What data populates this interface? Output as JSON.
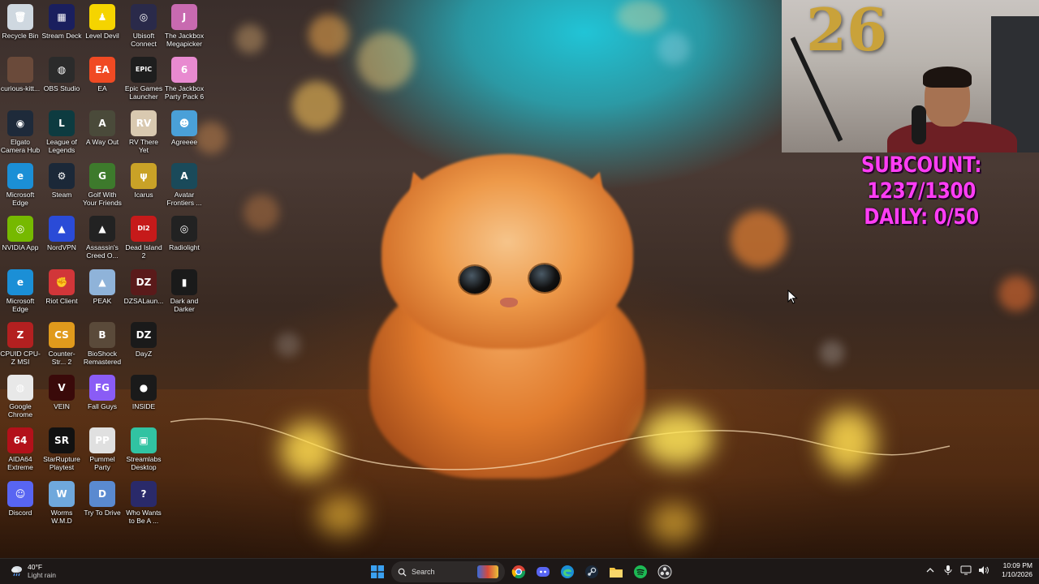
{
  "desktop": {
    "columns": [
      [
        {
          "label": "Recycle Bin",
          "icon": "recycle-bin-icon",
          "color": "#cfd8e0",
          "glyph": "🗑"
        },
        {
          "label": "curious-kitt...",
          "icon": "curious-kitty-icon",
          "color": "#6a4a3a",
          "glyph": ""
        },
        {
          "label": "Elgato Camera Hub",
          "icon": "elgato-icon",
          "color": "#1e2a3a",
          "glyph": "◉"
        },
        {
          "label": "Microsoft Edge",
          "icon": "edge-icon",
          "color": "#1b8fd6",
          "glyph": "e"
        },
        {
          "label": "NVIDIA App",
          "icon": "nvidia-icon",
          "color": "#76b900",
          "glyph": "◎"
        },
        {
          "label": "Microsoft Edge",
          "icon": "edge-icon",
          "color": "#1b8fd6",
          "glyph": "e"
        },
        {
          "label": "CPUID CPU-Z MSI",
          "icon": "cpuz-icon",
          "color": "#b32020",
          "glyph": "Z"
        },
        {
          "label": "Google Chrome",
          "icon": "chrome-icon",
          "color": "#e8e8e8",
          "glyph": "◍"
        },
        {
          "label": "AIDA64 Extreme",
          "icon": "aida64-icon",
          "color": "#b3111a",
          "glyph": "64"
        },
        {
          "label": "Discord",
          "icon": "discord-icon",
          "color": "#5865f2",
          "glyph": "☺"
        }
      ],
      [
        {
          "label": "Stream Deck",
          "icon": "stream-deck-icon",
          "color": "#1a1f5e",
          "glyph": "▦"
        },
        {
          "label": "OBS Studio",
          "icon": "obs-icon",
          "color": "#2b2b2b",
          "glyph": "◍"
        },
        {
          "label": "League of Legends",
          "icon": "league-icon",
          "color": "#0d3b40",
          "glyph": "L"
        },
        {
          "label": "Steam",
          "icon": "steam-icon",
          "color": "#1b2838",
          "glyph": "⚙"
        },
        {
          "label": "NordVPN",
          "icon": "nordvpn-icon",
          "color": "#2a4bd7",
          "glyph": "▲"
        },
        {
          "label": "Riot Client",
          "icon": "riot-icon",
          "color": "#d13639",
          "glyph": "✊"
        },
        {
          "label": "Counter-Str... 2",
          "icon": "cs2-icon",
          "color": "#e09a1c",
          "glyph": "CS"
        },
        {
          "label": "VEIN",
          "icon": "vein-icon",
          "color": "#3a0a0a",
          "glyph": "V"
        },
        {
          "label": "StarRupture Playtest",
          "icon": "starrupture-icon",
          "color": "#111111",
          "glyph": "SR"
        },
        {
          "label": "Worms W.M.D",
          "icon": "worms-icon",
          "color": "#6fa8dc",
          "glyph": "W"
        }
      ],
      [
        {
          "label": "Level Devil",
          "icon": "level-devil-icon",
          "color": "#f5d400",
          "glyph": "♟"
        },
        {
          "label": "EA",
          "icon": "ea-icon",
          "color": "#f04a23",
          "glyph": "EA"
        },
        {
          "label": "A Way Out",
          "icon": "a-way-out-icon",
          "color": "#4a4a3a",
          "glyph": "A"
        },
        {
          "label": "Golf With Your Friends",
          "icon": "golf-icon",
          "color": "#3d7a2c",
          "glyph": "G"
        },
        {
          "label": "Assassin's Creed O...",
          "icon": "assassins-creed-icon",
          "color": "#222222",
          "glyph": "▲"
        },
        {
          "label": "PEAK",
          "icon": "peak-icon",
          "color": "#8fb3d9",
          "glyph": "▲"
        },
        {
          "label": "BioShock Remastered",
          "icon": "bioshock-icon",
          "color": "#5a4a3a",
          "glyph": "B"
        },
        {
          "label": "Fall Guys",
          "icon": "fall-guys-icon",
          "color": "#8a5cf5",
          "glyph": "FG"
        },
        {
          "label": "Pummel Party",
          "icon": "pummel-party-icon",
          "color": "#e0e0e0",
          "glyph": "PP"
        },
        {
          "label": "Try To Drive",
          "icon": "try-to-drive-icon",
          "color": "#5a8ad0",
          "glyph": "D"
        }
      ],
      [
        {
          "label": "Ubisoft Connect",
          "icon": "ubisoft-icon",
          "color": "#2a2a4a",
          "glyph": "◎"
        },
        {
          "label": "Epic Games Launcher",
          "icon": "epic-games-icon",
          "color": "#1e1e1e",
          "glyph": "EPIC"
        },
        {
          "label": "RV There Yet",
          "icon": "rv-there-yet-icon",
          "color": "#d9c9b0",
          "glyph": "RV"
        },
        {
          "label": "Icarus",
          "icon": "icarus-icon",
          "color": "#c9a227",
          "glyph": "ψ"
        },
        {
          "label": "Dead Island 2",
          "icon": "dead-island-icon",
          "color": "#c61a1a",
          "glyph": "DI2"
        },
        {
          "label": "DZSALaun...",
          "icon": "dzsa-icon",
          "color": "#5a1a1a",
          "glyph": "DZ"
        },
        {
          "label": "DayZ",
          "icon": "dayz-icon",
          "color": "#1a1a1a",
          "glyph": "DZ"
        },
        {
          "label": "INSIDE",
          "icon": "inside-icon",
          "color": "#1a1a1a",
          "glyph": "●"
        },
        {
          "label": "Streamlabs Desktop",
          "icon": "streamlabs-icon",
          "color": "#31c3a2",
          "glyph": "▣"
        },
        {
          "label": "Who Wants to Be A ...",
          "icon": "millionaire-icon",
          "color": "#2a2a6a",
          "glyph": "?"
        }
      ],
      [
        {
          "label": "The Jackbox Megapicker",
          "icon": "jackbox-megapicker-icon",
          "color": "#c86ab0",
          "glyph": "J"
        },
        {
          "label": "The Jackbox Party Pack 6",
          "icon": "jackbox-6-icon",
          "color": "#e88ad0",
          "glyph": "6"
        },
        {
          "label": "Agreeee",
          "icon": "agreeee-icon",
          "color": "#4aa0d8",
          "glyph": "☻"
        },
        {
          "label": "Avatar Frontiers ...",
          "icon": "avatar-icon",
          "color": "#1a4a5a",
          "glyph": "A"
        },
        {
          "label": "Radiolight",
          "icon": "radiolight-icon",
          "color": "#222222",
          "glyph": "◎"
        },
        {
          "label": "Dark and Darker",
          "icon": "dark-and-darker-icon",
          "color": "#1a1a1a",
          "glyph": "▮"
        }
      ]
    ]
  },
  "overlay": {
    "subcount": "SUBCOUNT: 1237/1300",
    "daily": "DAILY: 0/50"
  },
  "webcam": {
    "balloon_text": "26"
  },
  "taskbar": {
    "weather_temp": "40°F",
    "weather_desc": "Light rain",
    "search_label": "Search",
    "time": "10:09 PM",
    "date": "1/10/2026",
    "pinned": [
      "start-icon",
      "search-icon",
      "widgets-icon",
      "chrome-icon",
      "discord-icon",
      "edge-icon",
      "steam-icon",
      "file-explorer-icon",
      "spotify-icon",
      "obs-icon"
    ]
  },
  "colors": {
    "overlay_text": "#ff3df5",
    "taskbar_bg": "#1c1818",
    "wallpaper_sky": "#21c4d6"
  }
}
